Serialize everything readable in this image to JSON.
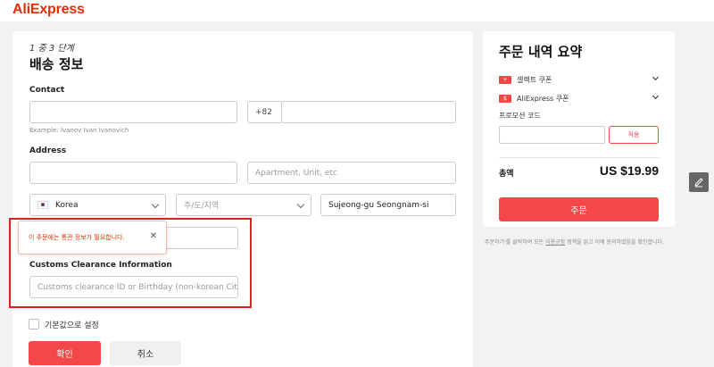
{
  "header": {
    "logo": "AliExpress"
  },
  "shipping": {
    "step": "1 중 3 단계",
    "title": "배송 정보",
    "contact_label": "Contact",
    "name_value": "",
    "phone_prefix": "+82",
    "phone_value": "",
    "name_hint": "Example: Ivanov Ivan Ivanovich",
    "address_label": "Address",
    "street_value": "",
    "apartment_placeholder": "Apartment, Unit, etc",
    "country": "Korea",
    "province_placeholder": "주/도/지역",
    "city_value": "Sujeong-gu Seongnam-si",
    "tooltip_text": "이 주문에는 통관 정보가 필요합니다.",
    "tooltip_close": "✕",
    "customs_label": "Customs Clearance Information",
    "customs_placeholder": "Customs clearance ID or Birthday (non-korean Citizens",
    "default_label": "기본값으로 설정",
    "confirm_label": "확인",
    "cancel_label": "취소"
  },
  "summary": {
    "title": "주문 내역 요약",
    "select_coupon": "셀렉트 쿠폰",
    "aliexpress_coupon": "AliExpress 쿠폰",
    "promo_label": "프로모션 코드",
    "promo_apply": "적용",
    "total_label": "총액",
    "total_value": "US $19.99",
    "order_label": "주문"
  },
  "terms": {
    "before": "주문하기'를 클릭하여 모든 ",
    "link": "이용규정",
    "after": " 정책을 읽고 이에 동의하였음을 확인합니다."
  },
  "colors": {
    "accent": "#f44848",
    "brand": "#e62e04",
    "highlight": "#e02020"
  }
}
